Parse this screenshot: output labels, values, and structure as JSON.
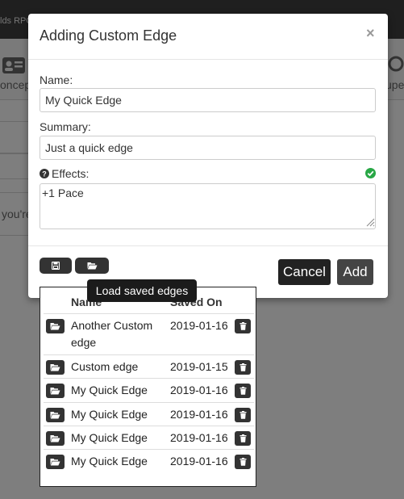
{
  "background": {
    "topbar_text": "lds RPG",
    "nav_left_label": "oncep",
    "nav_right_label": "upe",
    "partial_text": "you're"
  },
  "modal": {
    "title": "Adding Custom Edge",
    "close_label": "×",
    "name_label": "Name:",
    "name_value": "My Quick Edge",
    "summary_label": "Summary:",
    "summary_value": "Just a quick edge",
    "effects_label": "Effects:",
    "effects_value": "+1 Pace",
    "cancel_label": "Cancel",
    "add_label": "Add",
    "save_icon": "floppy-disk-icon",
    "open_icon": "folder-open-icon"
  },
  "tooltip": {
    "text": "Load saved edges"
  },
  "saved_edges": {
    "columns": {
      "name": "Name",
      "saved_on": "Saved On"
    },
    "rows": [
      {
        "name": "Another Custom edge",
        "saved_on": "2019-01-16"
      },
      {
        "name": "Custom edge",
        "saved_on": "2019-01-15"
      },
      {
        "name": "My Quick Edge",
        "saved_on": "2019-01-16"
      },
      {
        "name": "My Quick Edge",
        "saved_on": "2019-01-16"
      },
      {
        "name": "My Quick Edge",
        "saved_on": "2019-01-16"
      },
      {
        "name": "My Quick Edge",
        "saved_on": "2019-01-16"
      }
    ]
  },
  "colors": {
    "dark_button": "#333333",
    "ok_green": "#28a745"
  }
}
